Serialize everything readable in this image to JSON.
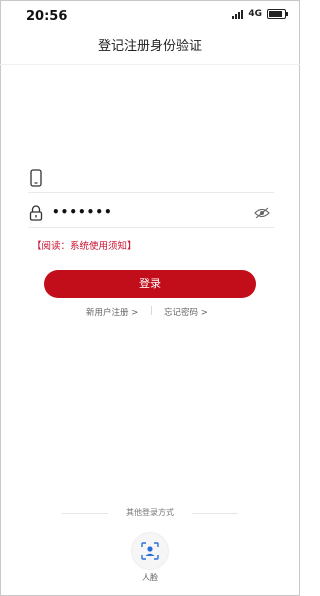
{
  "status_bar": {
    "time": "20:56",
    "network": "4G",
    "signal_icon": "signal-bars-icon",
    "battery_icon": "battery-icon",
    "battery_level": 0.85
  },
  "header": {
    "title": "登记注册身份验证"
  },
  "form": {
    "phone": {
      "icon": "phone-icon",
      "value": ""
    },
    "password": {
      "icon": "lock-icon",
      "value": "•••••••",
      "toggle_icon": "eye-hidden-icon"
    },
    "notice": "【阅读：系统使用须知】",
    "login_label": "登录"
  },
  "links": {
    "register": "新用户注册 >",
    "separator": "|",
    "forgot": "忘记密码 >"
  },
  "other_login": {
    "label": "其他登录方式",
    "face_icon": "face-recognition-icon",
    "face_label": "人脸"
  },
  "colors": {
    "accent": "#c20e1a",
    "notice": "#c8102e",
    "background": "#ffffff"
  }
}
